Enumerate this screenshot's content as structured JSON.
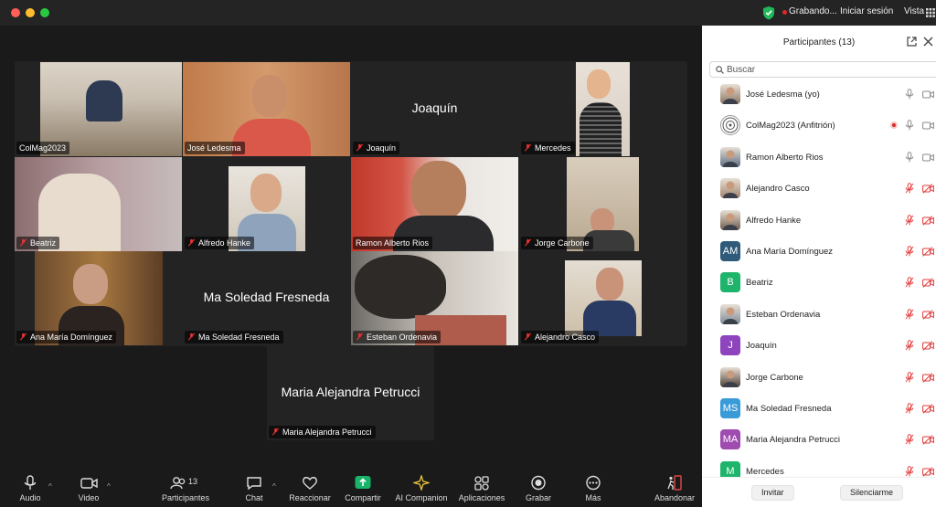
{
  "topbar": {
    "recording_label": "Grabando...",
    "signin_label": "Iniciar sesión",
    "view_label": "Vista",
    "colors": {
      "close": "#ff5f57",
      "minimize": "#febc2e",
      "zoom": "#28c840",
      "shield": "#1fb85a",
      "record": "#e02828"
    }
  },
  "gallery": {
    "tiles": [
      {
        "name": "ColMag2023",
        "display_name": ""
      },
      {
        "name": "José Ledesma",
        "display_name": ""
      },
      {
        "name": "Joaquín",
        "display_name": "Joaquín"
      },
      {
        "name": "Mercedes",
        "display_name": ""
      },
      {
        "name": "Beatriz",
        "display_name": ""
      },
      {
        "name": "Alfredo Hanke",
        "display_name": ""
      },
      {
        "name": "Ramon Alberto Rios",
        "display_name": ""
      },
      {
        "name": "Jorge Carbone",
        "display_name": ""
      },
      {
        "name": "Ana María Domínguez",
        "display_name": ""
      },
      {
        "name": "Ma Soledad Fresneda",
        "display_name": "Ma Soledad Fresneda"
      },
      {
        "name": "Esteban Ordenavia",
        "display_name": ""
      },
      {
        "name": "Alejandro Casco",
        "display_name": ""
      },
      {
        "name": "Maria Alejandra Petrucci",
        "display_name": "Maria Alejandra Petrucci"
      }
    ],
    "active_speaker_color": "#3ea84c"
  },
  "toolbar": {
    "audio": "Audio",
    "video": "Video",
    "participants": "Participantes",
    "participants_count": "13",
    "chat": "Chat",
    "react": "Reaccionar",
    "share": "Compartir",
    "ai": "AI Companion",
    "apps": "Aplicaciones",
    "record": "Grabar",
    "more": "Más",
    "leave": "Abandonar",
    "share_color": "#19b46a"
  },
  "panel": {
    "title": "Participantes (13)",
    "search_placeholder": "Buscar",
    "participants": [
      {
        "name": "José Ledesma (yo)",
        "avatar": "photo",
        "mic": "on",
        "recording": false
      },
      {
        "name": "ColMag2023 (Anfitrión)",
        "avatar": "logo",
        "mic": "on",
        "recording": true
      },
      {
        "name": "Ramon Alberto Rios",
        "avatar": "photo",
        "mic": "on",
        "recording": false
      },
      {
        "name": "Alejandro Casco",
        "avatar": "photo",
        "mic": "muted",
        "recording": false
      },
      {
        "name": "Alfredo Hanke",
        "avatar": "photo",
        "mic": "muted",
        "recording": false
      },
      {
        "name": "Ana María Domínguez",
        "avatar": "AM",
        "avatar_color": "#2f5a79",
        "mic": "muted",
        "recording": false
      },
      {
        "name": "Beatriz",
        "avatar": "B",
        "avatar_color": "#1fb46b",
        "mic": "muted",
        "recording": false
      },
      {
        "name": "Esteban Ordenavia",
        "avatar": "photo",
        "mic": "muted",
        "recording": false
      },
      {
        "name": "Joaquín",
        "avatar": "J",
        "avatar_color": "#8e44bd",
        "mic": "muted",
        "recording": false
      },
      {
        "name": "Jorge Carbone",
        "avatar": "photo",
        "mic": "muted",
        "recording": false
      },
      {
        "name": "Ma Soledad Fresneda",
        "avatar": "MS",
        "avatar_color": "#3a9bd9",
        "mic": "muted",
        "recording": false
      },
      {
        "name": "Maria Alejandra Petrucci",
        "avatar": "MA",
        "avatar_color": "#a04bb0",
        "mic": "muted",
        "recording": false
      },
      {
        "name": "Mercedes",
        "avatar": "M",
        "avatar_color": "#1fb46b",
        "mic": "muted",
        "recording": false
      }
    ],
    "invite_label": "Invitar",
    "mute_all_label": "Silenciarme"
  }
}
